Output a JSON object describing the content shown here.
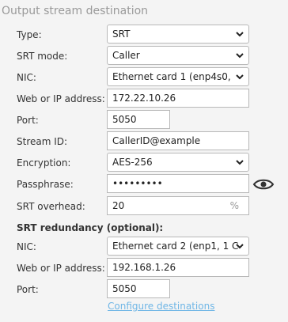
{
  "title": "Output stream destination",
  "fields": {
    "type": {
      "label": "Type:",
      "value": "SRT"
    },
    "srt_mode": {
      "label": "SRT mode:",
      "value": "Caller"
    },
    "nic": {
      "label": "NIC:",
      "value": "Ethernet card 1 (enp4s0,"
    },
    "address": {
      "label": "Web or IP address:",
      "value": "172.22.10.26"
    },
    "port": {
      "label": "Port:",
      "value": "5050"
    },
    "stream_id": {
      "label": "Stream ID:",
      "value": "CallerID@example"
    },
    "encryption": {
      "label": "Encryption:",
      "value": "AES-256"
    },
    "passphrase": {
      "label": "Passphrase:",
      "value": "•••••••••"
    },
    "overhead": {
      "label": "SRT overhead:",
      "value": "20",
      "unit": "%"
    }
  },
  "redundancy": {
    "heading": "SRT redundancy (optional):",
    "nic": {
      "label": "NIC:",
      "value": "Ethernet card 2 (enp1, 1 C"
    },
    "address": {
      "label": "Web or IP address:",
      "value": "192.168.1.26"
    },
    "port": {
      "label": "Port:",
      "value": "5050"
    }
  },
  "link": "Configure destinations",
  "icons": {
    "dropdown": "chevron-down-icon",
    "reveal": "eye-icon"
  }
}
